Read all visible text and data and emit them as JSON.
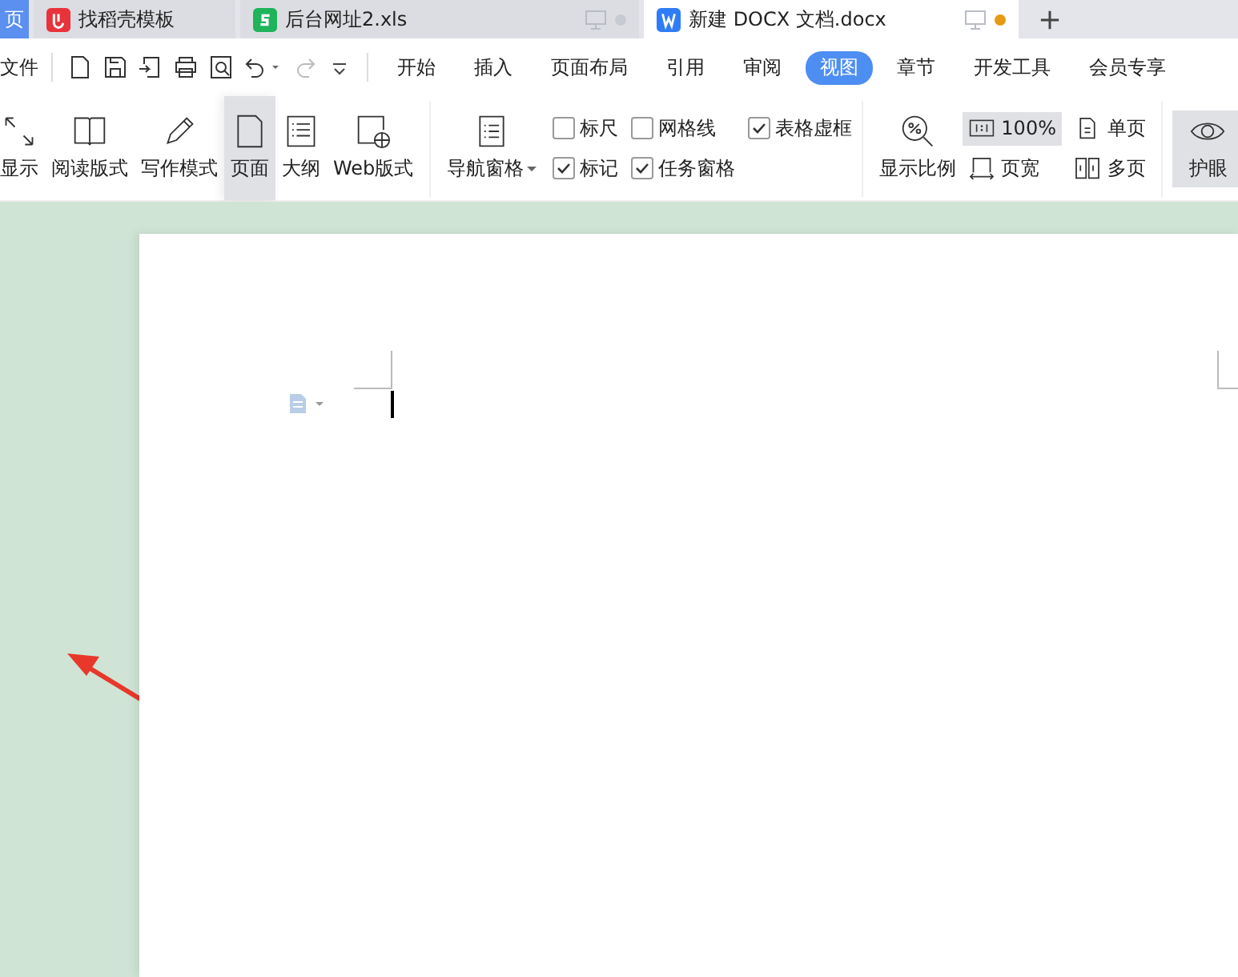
{
  "tabs": [
    {
      "kind": "home",
      "label": "页",
      "selected": false
    },
    {
      "kind": "template",
      "label": "找稻壳模板",
      "selected": false
    },
    {
      "kind": "sheet",
      "label": "后台网址2.xls",
      "selected": false
    },
    {
      "kind": "doc",
      "label": "新建 DOCX 文档.docx",
      "selected": true
    }
  ],
  "file_menu": "文件",
  "menu_tabs": [
    {
      "label": "开始",
      "selected": false
    },
    {
      "label": "插入",
      "selected": false
    },
    {
      "label": "页面布局",
      "selected": false
    },
    {
      "label": "引用",
      "selected": false
    },
    {
      "label": "审阅",
      "selected": false
    },
    {
      "label": "视图",
      "selected": true
    },
    {
      "label": "章节",
      "selected": false
    },
    {
      "label": "开发工具",
      "selected": false
    },
    {
      "label": "会员专享",
      "selected": false
    }
  ],
  "view_buttons": [
    {
      "kind": "fullscreen",
      "label": "显示",
      "selected": false
    },
    {
      "kind": "read",
      "label": "阅读版式",
      "selected": false
    },
    {
      "kind": "write",
      "label": "写作模式",
      "selected": false
    },
    {
      "kind": "page",
      "label": "页面",
      "selected": true
    },
    {
      "kind": "outline",
      "label": "大纲",
      "selected": false
    },
    {
      "kind": "web",
      "label": "Web版式",
      "selected": false
    }
  ],
  "nav_pane": "导航窗格",
  "checkboxes": [
    {
      "label": "标尺",
      "checked": false
    },
    {
      "label": "网格线",
      "checked": false
    },
    {
      "label": "表格虚框",
      "checked": true
    },
    {
      "label": "标记",
      "checked": true
    },
    {
      "label": "任务窗格",
      "checked": true
    }
  ],
  "zoom": {
    "label": "显示比例",
    "items": [
      {
        "kind": "percent",
        "label": "100%",
        "selected": true
      },
      {
        "kind": "single",
        "label": "单页",
        "selected": false
      },
      {
        "kind": "width",
        "label": "页宽",
        "selected": false
      },
      {
        "kind": "multi",
        "label": "多页",
        "selected": false
      }
    ]
  },
  "eye_care": {
    "label": "护眼",
    "selected": true
  }
}
